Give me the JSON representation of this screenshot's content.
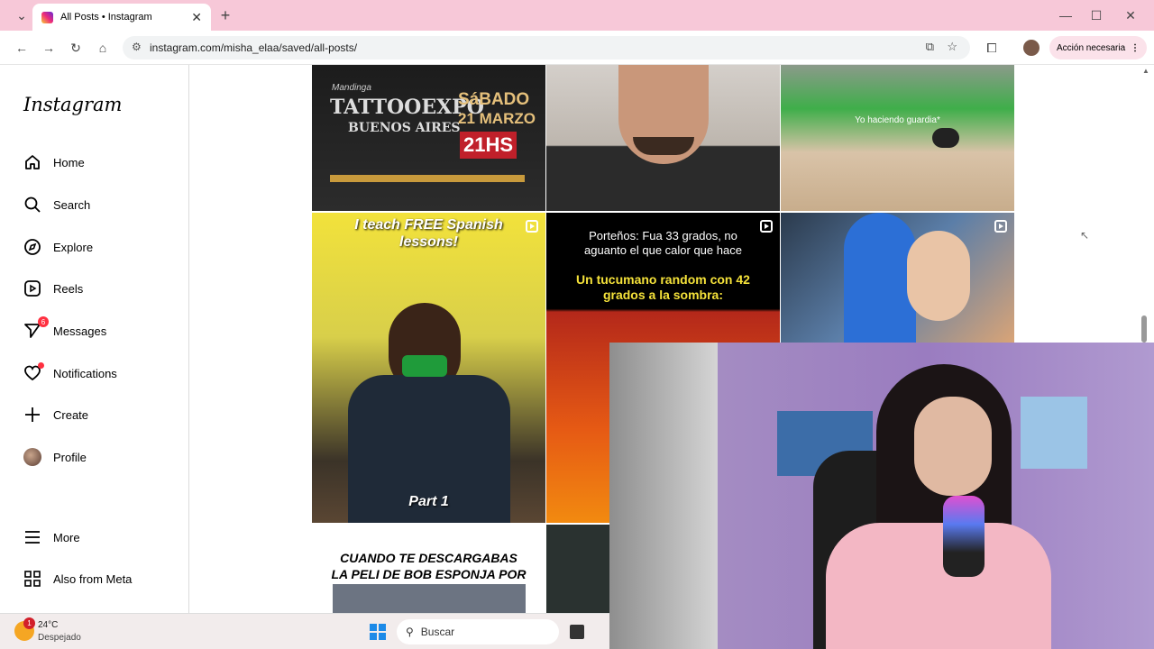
{
  "browser": {
    "tab_title": "All Posts • Instagram",
    "url": "instagram.com/misha_elaa/saved/all-posts/",
    "action_label": "Acción necesaria"
  },
  "sidebar": {
    "logo": "Instagram",
    "items": [
      {
        "label": "Home",
        "icon": "home-icon"
      },
      {
        "label": "Search",
        "icon": "search-icon"
      },
      {
        "label": "Explore",
        "icon": "compass-icon"
      },
      {
        "label": "Reels",
        "icon": "reels-icon"
      },
      {
        "label": "Messages",
        "icon": "messenger-icon",
        "badge": "6"
      },
      {
        "label": "Notifications",
        "icon": "heart-icon"
      },
      {
        "label": "Create",
        "icon": "plus-icon"
      },
      {
        "label": "Profile",
        "icon": "avatar-icon"
      }
    ],
    "more": "More",
    "also": "Also from Meta"
  },
  "posts": {
    "p1": {
      "brand": "Mandinga",
      "title": "TATTOOEXPO",
      "subtitle": "BUENOS AIRES",
      "day": "SáBADO",
      "date": "21 MARZO",
      "time": "21HS"
    },
    "p3": {
      "caption": "Yo haciendo guardia*"
    },
    "p4": {
      "caption": "I teach FREE Spanish lessons!",
      "footer": "Part 1"
    },
    "p5": {
      "caption": "Porteños: Fua 33 grados, no aguanto el que calor que hace",
      "caption2": "Un tucumano random con 42 grados a la sombra:"
    },
    "p7": {
      "caption": "CUANDO TE DESCARGABAS LA PELI DE BOB ESPONJA POR EL ARES"
    }
  },
  "taskbar": {
    "weather_temp": "24°C",
    "weather_desc": "Despejado",
    "weather_badge": "1",
    "search": "Buscar"
  },
  "colors": {
    "tab_bg": "#f7c8d8",
    "badge": "#ff3040",
    "action_pill": "#fbe2ea"
  }
}
